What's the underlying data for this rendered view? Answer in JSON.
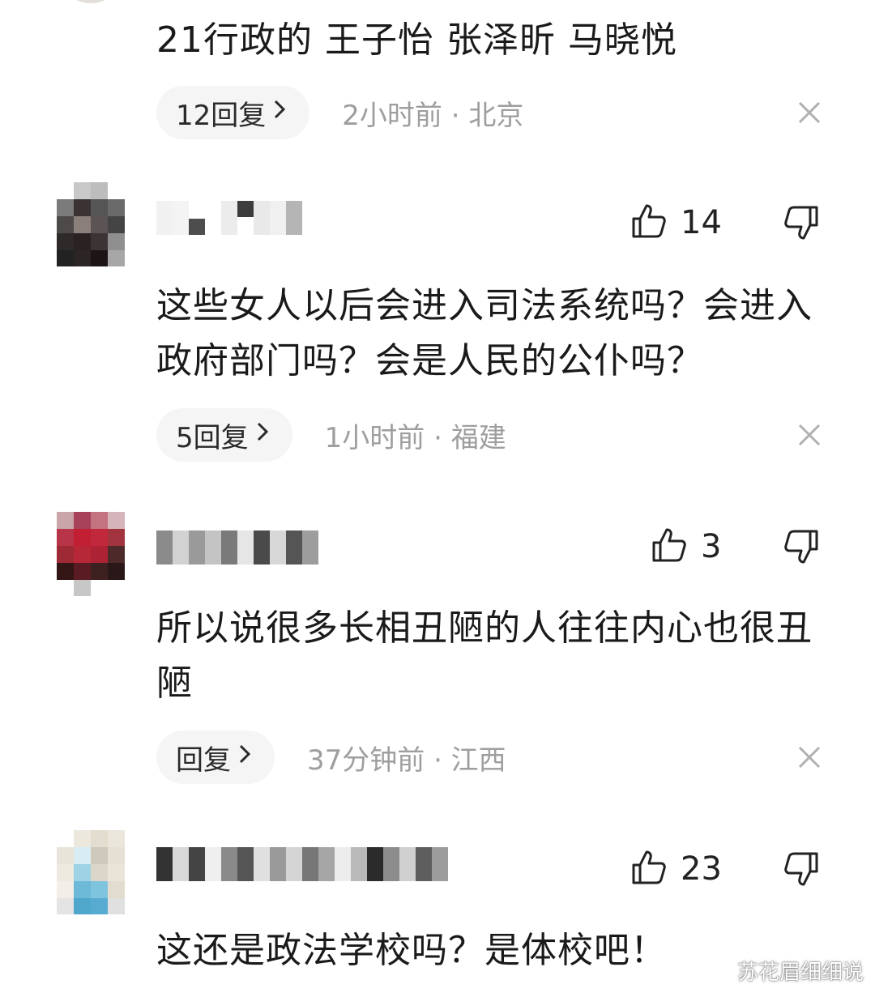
{
  "comments": [
    {
      "text": "21行政的 王子怡 张泽昕 马晓悦",
      "reply_label": "12回复",
      "time_location": "2小时前 · 北京"
    },
    {
      "likes": "14",
      "text": "这些女人以后会进入司法系统吗？会进入政府部门吗？会是人民的公仆吗？",
      "reply_label": "5回复",
      "time_location": "1小时前 · 福建"
    },
    {
      "likes": "3",
      "text": "所以说很多长相丑陋的人往往内心也很丑陋",
      "reply_label": "回复",
      "time_location": "37分钟前 · 江西"
    },
    {
      "likes": "23",
      "text": "这还是政法学校吗？是体校吧！"
    }
  ],
  "icons": {
    "like": "thumbs-up-icon",
    "dislike": "thumbs-down-icon",
    "close": "close-icon",
    "chevron": "chevron-right-icon"
  },
  "colors": {
    "text": "#1a1a1a",
    "meta": "#9e9e9e",
    "pill_bg": "#f5f5f5"
  },
  "watermark": "苏花眉细细说"
}
